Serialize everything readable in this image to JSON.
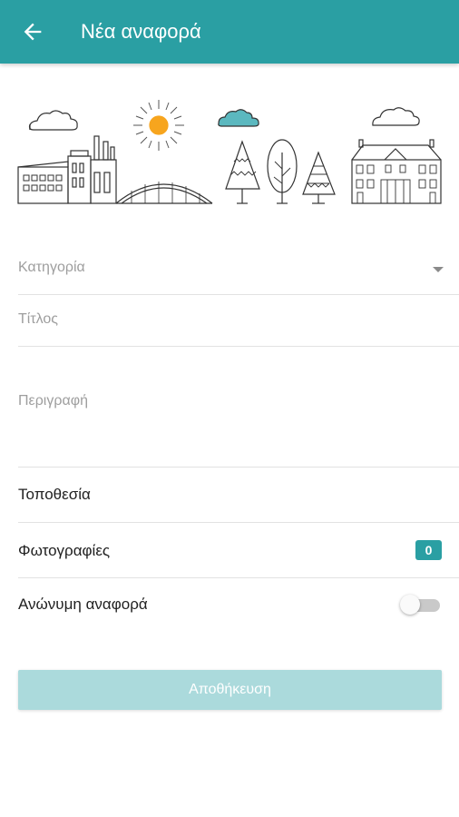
{
  "header": {
    "title": "Νέα αναφορά"
  },
  "form": {
    "category_placeholder": "Κατηγορία",
    "title_placeholder": "Τίτλος",
    "description_placeholder": "Περιγραφή",
    "location_label": "Τοποθεσία",
    "photos_label": "Φωτογραφίες",
    "photos_count": "0",
    "anonymous_label": "Ανώνυμη αναφορά",
    "anonymous_enabled": false
  },
  "actions": {
    "save_label": "Αποθήκευση"
  },
  "colors": {
    "primary": "#2a9fa3",
    "primary_disabled": "#abdadc",
    "sun": "#f7a51e",
    "cloud_accent": "#5bb8bf"
  }
}
